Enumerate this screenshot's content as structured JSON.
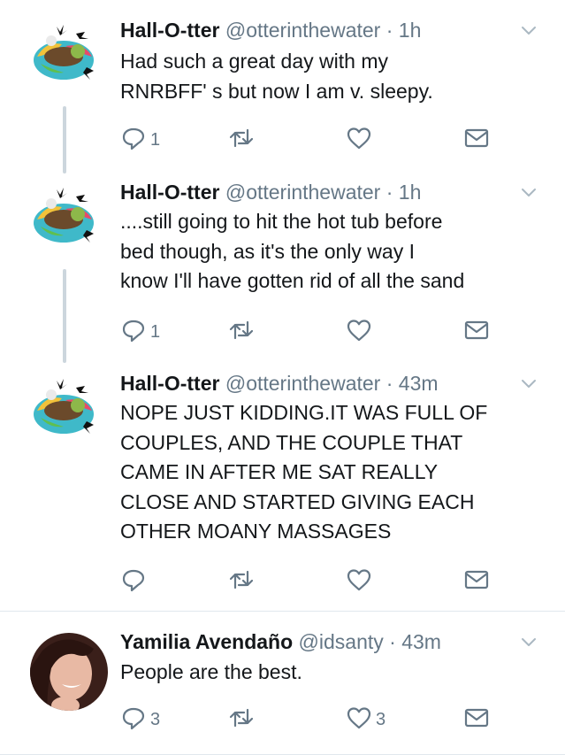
{
  "colors": {
    "text": "#14171a",
    "muted": "#657786",
    "icon": "#657786",
    "thread_line": "#ccd6dd",
    "divider": "#e1e8ed"
  },
  "tweets": [
    {
      "name": "Hall-O-tter",
      "handle": "@otterinthewater",
      "dot": "·",
      "time": "1h",
      "text": [
        "Had such a great day with my",
        "RNRBFF' s but now I am v. sleepy."
      ],
      "reply_count": "1",
      "retweet_count": "",
      "like_count": ""
    },
    {
      "name": "Hall-O-tter",
      "handle": "@otterinthewater",
      "dot": "·",
      "time": "1h",
      "text": [
        "....still going to hit the hot tub before",
        "bed though, as it's the only way I",
        "know I'll have gotten rid of all the sand"
      ],
      "reply_count": "1",
      "retweet_count": "",
      "like_count": ""
    },
    {
      "name": "Hall-O-tter",
      "handle": "@otterinthewater",
      "dot": "·",
      "time": "43m",
      "text": [
        "NOPE JUST KIDDING.IT WAS FULL OF",
        "COUPLES, AND THE COUPLE THAT",
        "CAME IN AFTER ME SAT REALLY",
        "CLOSE AND STARTED GIVING EACH",
        "OTHER MOANY MASSAGES"
      ],
      "reply_count": "",
      "retweet_count": "",
      "like_count": ""
    },
    {
      "name": "Yamilia Avendaño",
      "handle": "@idsanty",
      "dot": "·",
      "time": "43m",
      "text": [
        "People are the best."
      ],
      "reply_count": "3",
      "retweet_count": "",
      "like_count": "3"
    }
  ],
  "icons": {
    "reply": "reply-icon",
    "retweet": "retweet-icon",
    "like": "heart-icon",
    "dm": "envelope-icon",
    "more": "chevron-down-icon"
  }
}
